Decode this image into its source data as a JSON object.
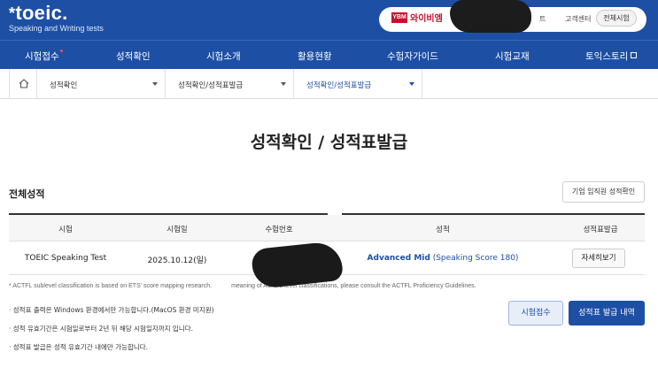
{
  "header": {
    "logo_text": "toeic.",
    "logo_star": "*",
    "logo_subtitle": "Speaking and Writing tests",
    "partner_mark": "YBM",
    "partner_label": "와이비엠",
    "links": [
      "트",
      "고객센터"
    ],
    "all_tests_button": "전체시험"
  },
  "nav": {
    "items": [
      "시험접수",
      "성적확인",
      "시험소개",
      "활용현황",
      "수험자가이드",
      "시험교재",
      "토익스토리"
    ]
  },
  "breadcrumb": {
    "items": [
      "성적확인",
      "성적확인/성적표발급",
      "성적확인/성적표발급"
    ]
  },
  "page": {
    "title": "성적확인 / 성적표발급",
    "section_title": "전체성적",
    "corporate_button": "기업 임직원 성적확인"
  },
  "table": {
    "headers": [
      "시험",
      "시험일",
      "수험번호",
      "성적",
      "성적표발급"
    ],
    "rows": [
      {
        "test": "TOEIC Speaking Test",
        "date": "2025.10.12(일)",
        "reg_no": "",
        "score_level": "Advanced Mid",
        "score_detail": "(Speaking Score 180)",
        "action": "자세히보기"
      }
    ]
  },
  "notes": {
    "actfl_left": "* ACTFL sublevel classification is based on ETS' score mapping research.",
    "actfl_right": "meaning of ACTFL level classifications, please consult the ACTFL Proficiency Guidelines.",
    "bullets": [
      "· 성적표 출력은 Windows 환경에서만 가능합니다.(MacOS 환경 미지원)",
      "· 성적 유효기간은 시험일로부터 2년 뒤 해당 시험일자까지 입니다.",
      "· 성적표 발급은 성적 유효기간 내에만 가능합니다."
    ]
  },
  "actions": {
    "exam_apply": "시험접수",
    "history": "성적표 발급 내역"
  },
  "colors": {
    "brand_blue": "#1d4fa5",
    "partner_red": "#c8102e"
  },
  "icons": {
    "home": "home-icon",
    "external": "external-link-icon",
    "caret": "chevron-down-icon"
  }
}
